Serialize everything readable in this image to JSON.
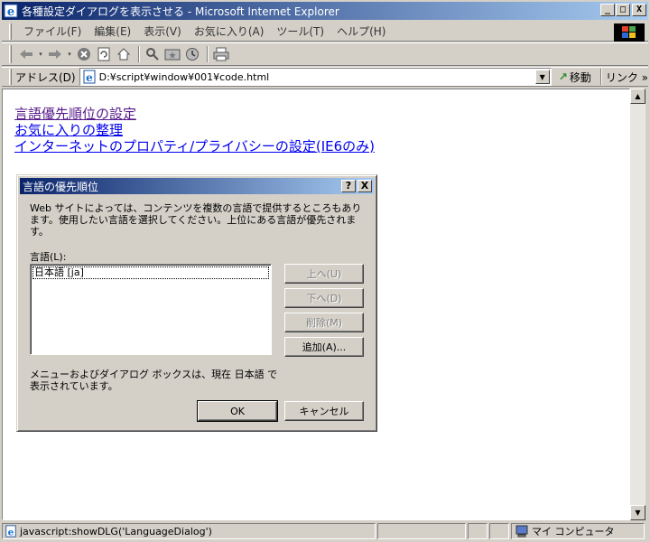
{
  "window": {
    "title": "各種設定ダイアログを表示させる - Microsoft Internet Explorer",
    "minimize": "_",
    "maximize": "□",
    "close": "X"
  },
  "menu": {
    "items": [
      {
        "label": "ファイル(F)"
      },
      {
        "label": "編集(E)"
      },
      {
        "label": "表示(V)"
      },
      {
        "label": "お気に入り(A)"
      },
      {
        "label": "ツール(T)"
      },
      {
        "label": "ヘルプ(H)"
      }
    ]
  },
  "toolbar": {
    "icons": [
      "back-icon",
      "forward-icon",
      "stop-icon",
      "refresh-icon",
      "home-icon",
      "search-icon",
      "favorites-icon",
      "history-icon",
      "print-icon"
    ]
  },
  "address": {
    "label": "アドレス(D)",
    "value": "D:¥script¥window¥001¥code.html",
    "go_label": "移動",
    "links_label": "リンク »"
  },
  "content": {
    "links": [
      {
        "label": "言語優先順位の設定",
        "visited": true
      },
      {
        "label": "お気に入りの整理",
        "visited": false
      },
      {
        "label": "インターネットのプロパティ/プライバシーの設定(IE6のみ)",
        "visited": false
      }
    ]
  },
  "dialog": {
    "title": "言語の優先順位",
    "help_btn": "?",
    "close_btn": "X",
    "description": "Web サイトによっては、コンテンツを複数の言語で提供するところもあります。使用したい言語を選択してください。上位にある言語が優先されます。",
    "list_label": "言語(L):",
    "languages": [
      "日本語 [ja]"
    ],
    "buttons": {
      "up": "上へ(U)",
      "down": "下へ(D)",
      "remove": "削除(M)",
      "add": "追加(A)..."
    },
    "note": "メニューおよびダイアログ ボックスは、現在 日本語 で表示されています。",
    "ok": "OK",
    "cancel": "キャンセル"
  },
  "status": {
    "text": "javascript:showDLG('LanguageDialog')",
    "zone": "マイ コンピュータ"
  }
}
